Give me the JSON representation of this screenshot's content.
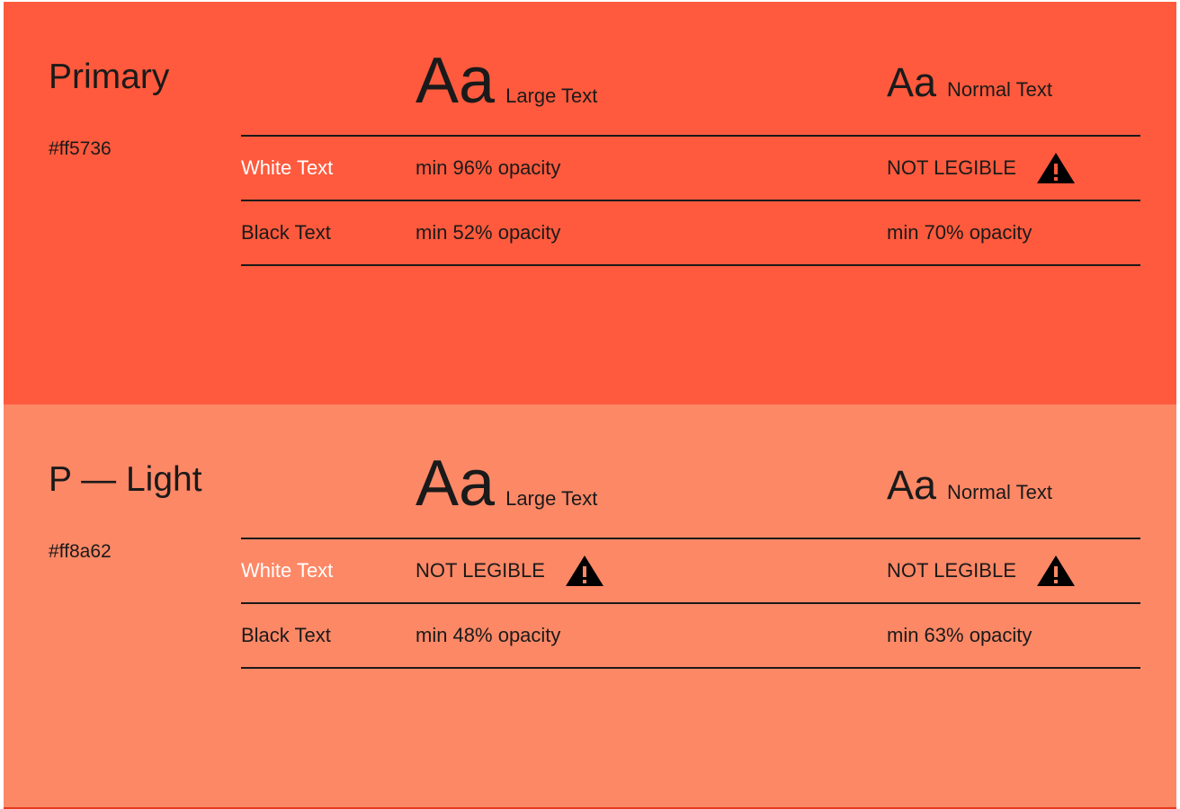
{
  "colors": {
    "primary_bg": "#ff5a3d",
    "light_bg": "#fd8866",
    "text_dark": "#1a1a1a",
    "text_white": "#ffffff"
  },
  "icons": {
    "warning": "warning-triangle-icon"
  },
  "panels": [
    {
      "name": "Primary",
      "hex": "#ff5736",
      "large_sample": "Aa",
      "large_label": "Large Text",
      "normal_sample": "Aa",
      "normal_label": "Normal Text",
      "rows": [
        {
          "label": "White Text",
          "large": "min 96% opacity",
          "large_warning": false,
          "normal": "NOT LEGIBLE",
          "normal_warning": true
        },
        {
          "label": "Black Text",
          "large": "min 52% opacity",
          "large_warning": false,
          "normal": "min 70% opacity",
          "normal_warning": false
        }
      ]
    },
    {
      "name": "P — Light",
      "hex": "#ff8a62",
      "large_sample": "Aa",
      "large_label": "Large Text",
      "normal_sample": "Aa",
      "normal_label": "Normal Text",
      "rows": [
        {
          "label": "White Text",
          "large": "NOT LEGIBLE",
          "large_warning": true,
          "normal": "NOT LEGIBLE",
          "normal_warning": true
        },
        {
          "label": "Black Text",
          "large": "min 48% opacity",
          "large_warning": false,
          "normal": "min 63% opacity",
          "normal_warning": false
        }
      ]
    }
  ]
}
